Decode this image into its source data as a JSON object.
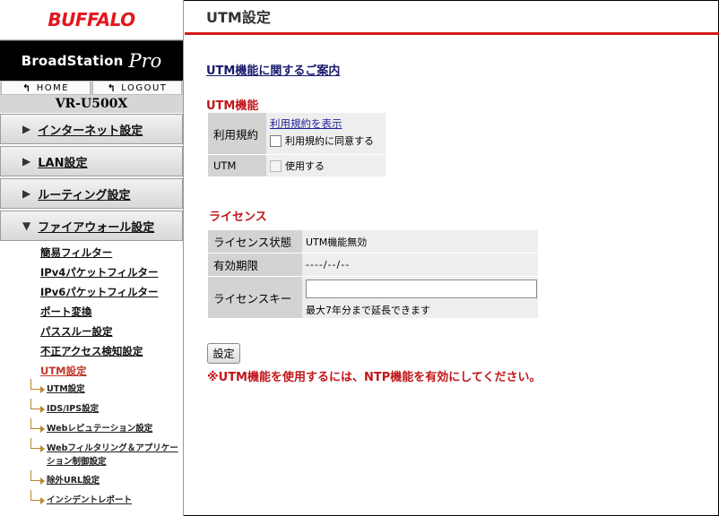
{
  "brand": {
    "logo": "BUFFALO",
    "product_name": "BroadStation",
    "product_suffix": "Pro",
    "model": "VR-U500X"
  },
  "nav": {
    "home": "HOME",
    "logout": "LOGOUT"
  },
  "menu": [
    {
      "label": "インターネット設定",
      "expanded": false
    },
    {
      "label": "LAN設定",
      "expanded": false
    },
    {
      "label": "ルーティング設定",
      "expanded": false
    },
    {
      "label": "ファイアウォール設定",
      "expanded": true
    }
  ],
  "submenu": [
    {
      "label": "簡易フィルター"
    },
    {
      "label": "IPv4パケットフィルター"
    },
    {
      "label": "IPv6パケットフィルター"
    },
    {
      "label": "ポート変換"
    },
    {
      "label": "パススルー設定"
    },
    {
      "label": "不正アクセス検知設定"
    },
    {
      "label": "UTM設定"
    }
  ],
  "subsubmenu": [
    {
      "label": "UTM設定"
    },
    {
      "label": "IDS/IPS設定"
    },
    {
      "label": "Webレピュテーション設定"
    },
    {
      "label": "Webフィルタリング＆アプリケーション制御設定"
    },
    {
      "label": "除外URL設定"
    },
    {
      "label": "インシデントレポート"
    }
  ],
  "page": {
    "title": "UTM設定",
    "info_link": "UTM機能に関するご案内",
    "utm_section": {
      "title": "UTM機能",
      "terms_label": "利用規約",
      "terms_link": "利用規約を表示",
      "agree_label": "利用規約に同意する",
      "agree_checked": false,
      "utm_label": "UTM",
      "use_label": "使用する",
      "use_checked": false
    },
    "license_section": {
      "title": "ライセンス",
      "status_label": "ライセンス状態",
      "status_value": "UTM機能無効",
      "expiry_label": "有効期限",
      "expiry_value": "----/--/--",
      "key_label": "ライセンスキー",
      "key_value": "",
      "key_note": "最大7年分まで延長できます"
    },
    "set_button": "設定",
    "notice": "※UTM機能を使用するには、NTP機能を有効にしてください。"
  }
}
